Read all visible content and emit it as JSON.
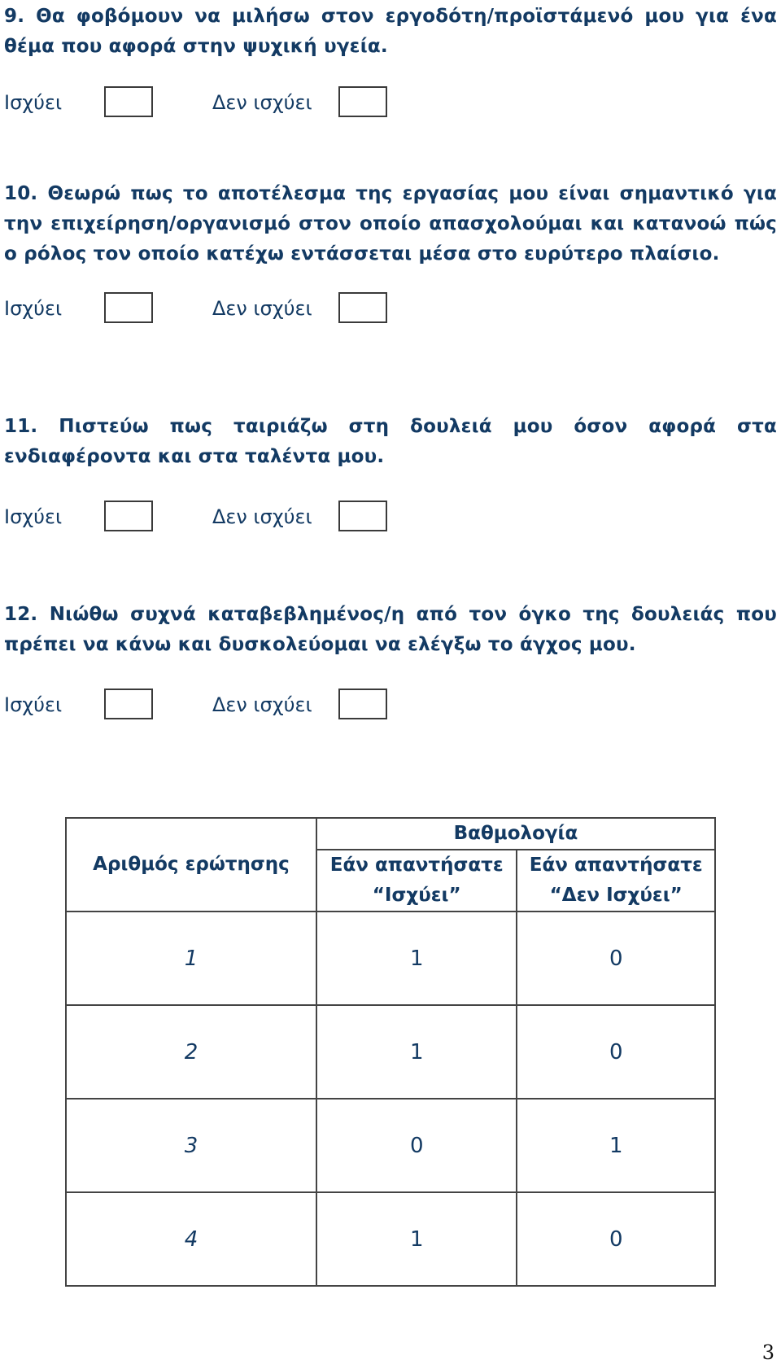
{
  "questions": [
    {
      "number": "9.",
      "text": "Θα φοβόμουν να μιλήσω στον εργοδότη/προϊστάμενό μου για ένα θέμα που αφορά στην ψυχική υγεία.",
      "option_yes": "Ισχύει",
      "option_no": "Δεν ισχύει"
    },
    {
      "number": "10.",
      "text": "Θεωρώ πως το αποτέλεσμα της εργασίας μου είναι σημαντικό για την επιχείρηση/οργανισμό στον οποίο απασχολούμαι και κατανοώ πώς ο ρόλος τον οποίο κατέχω εντάσσεται μέσα στο ευρύτερο πλαίσιο.",
      "option_yes": "Ισχύει",
      "option_no": "Δεν ισχύει"
    },
    {
      "number": "11.",
      "text": "Πιστεύω πως ταιριάζω στη δουλειά μου όσον αφορά στα ενδιαφέροντα και στα ταλέντα μου.",
      "option_yes": "Ισχύει",
      "option_no": "Δεν ισχύει"
    },
    {
      "number": "12.",
      "text": "Νιώθω συχνά καταβεβλημένος/η από τον όγκο της δουλειάς που πρέπει να κάνω και δυσκολεύομαι να ελέγξω το άγχος μου.",
      "option_yes": "Ισχύει",
      "option_no": "Δεν ισχύει"
    }
  ],
  "score_table": {
    "group_header": "Βαθμολογία",
    "col_question": "Αριθμός ερώτησης",
    "col_yes": "Εάν απαντήσατε “Ισχύει”",
    "col_no": "Εάν απαντήσατε “Δεν Ισχύει”",
    "rows": [
      {
        "question": "1",
        "yes": "1",
        "no": "0"
      },
      {
        "question": "2",
        "yes": "1",
        "no": "0"
      },
      {
        "question": "3",
        "yes": "0",
        "no": "1"
      },
      {
        "question": "4",
        "yes": "1",
        "no": "0"
      }
    ]
  },
  "page_number": "3"
}
